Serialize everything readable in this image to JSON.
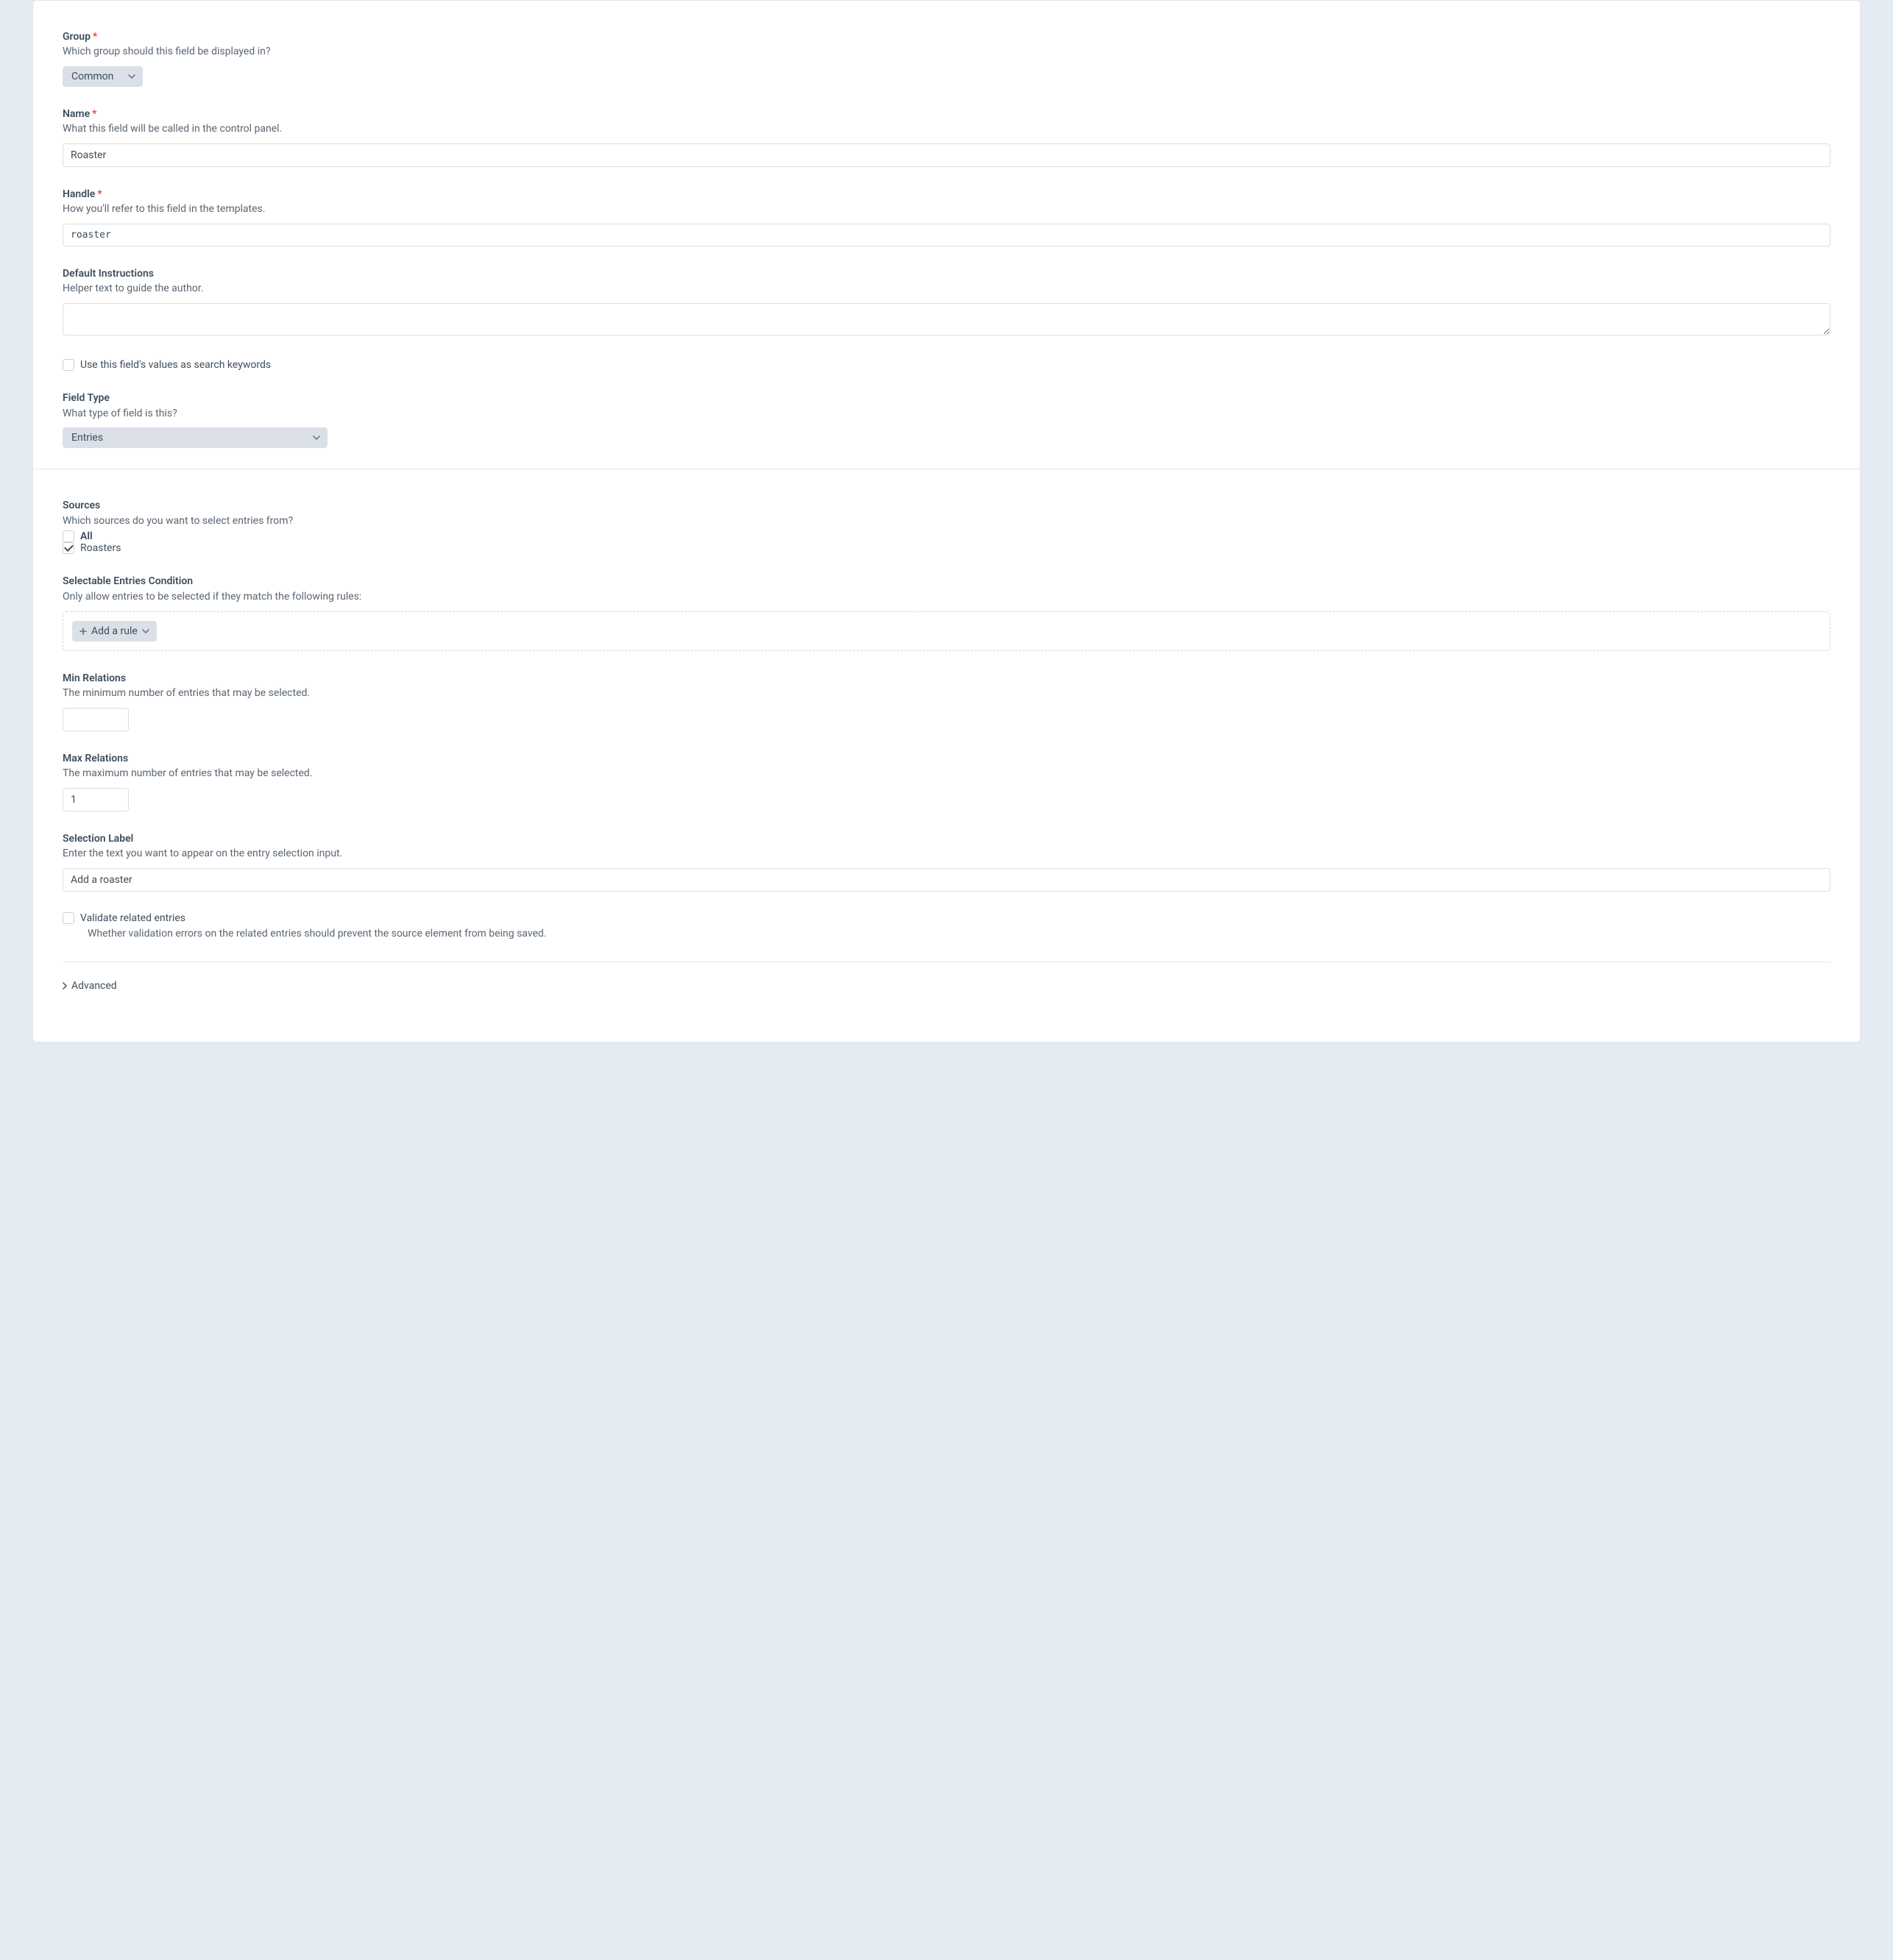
{
  "fields": {
    "group": {
      "label": "Group",
      "required": true,
      "help": "Which group should this field be displayed in?",
      "value": "Common"
    },
    "name": {
      "label": "Name",
      "required": true,
      "help": "What this field will be called in the control panel.",
      "value": "Roaster"
    },
    "handle": {
      "label": "Handle",
      "required": true,
      "help": "How you'll refer to this field in the templates.",
      "value": "roaster"
    },
    "instructions": {
      "label": "Default Instructions",
      "help": "Helper text to guide the author.",
      "value": ""
    },
    "searchKeywords": {
      "label": "Use this field's values as search keywords",
      "checked": false
    },
    "fieldType": {
      "label": "Field Type",
      "help": "What type of field is this?",
      "value": "Entries"
    },
    "sources": {
      "label": "Sources",
      "help": "Which sources do you want to select entries from?",
      "options": [
        {
          "label": "All",
          "checked": false,
          "bold": true
        },
        {
          "label": "Roasters",
          "checked": true,
          "bold": false
        }
      ]
    },
    "condition": {
      "label": "Selectable Entries Condition",
      "help": "Only allow entries to be selected if they match the following rules:",
      "button": "Add a rule"
    },
    "minRelations": {
      "label": "Min Relations",
      "help": "The minimum number of entries that may be selected.",
      "value": ""
    },
    "maxRelations": {
      "label": "Max Relations",
      "help": "The maximum number of entries that may be selected.",
      "value": "1"
    },
    "selectionLabel": {
      "label": "Selection Label",
      "help": "Enter the text you want to appear on the entry selection input.",
      "value": "Add a roaster"
    },
    "validateRelated": {
      "label": "Validate related entries",
      "checked": false,
      "help": "Whether validation errors on the related entries should prevent the source element from being saved."
    },
    "advanced": {
      "label": "Advanced"
    }
  }
}
